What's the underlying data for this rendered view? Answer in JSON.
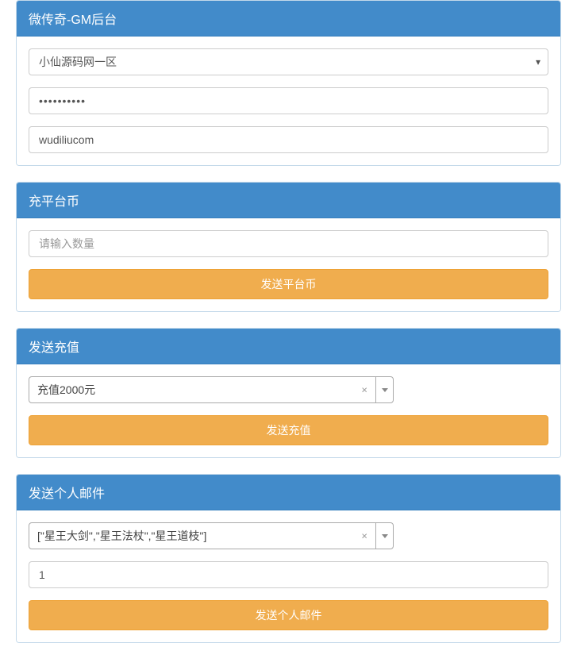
{
  "panel1": {
    "title": "微传奇-GM后台",
    "server_selected": "小仙源码网一区",
    "password_value": "••••••••••",
    "username_value": "wudiliucom"
  },
  "panel2": {
    "title": "充平台币",
    "amount_placeholder": "请输入数量",
    "button_label": "发送平台币"
  },
  "panel3": {
    "title": "发送充值",
    "recharge_selected": "充值2000元",
    "button_label": "发送充值"
  },
  "panel4": {
    "title": "发送个人邮件",
    "items_selected": "[\"星王大剑\",\"星王法杖\",\"星王道枝\"]",
    "quantity_value": "1",
    "button_label": "发送个人邮件"
  }
}
